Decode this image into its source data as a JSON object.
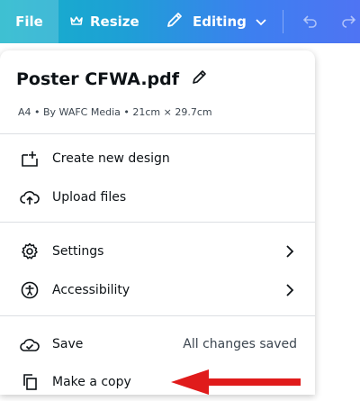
{
  "topbar": {
    "file_label": "File",
    "resize_label": "Resize",
    "editing_label": "Editing"
  },
  "panel": {
    "title": "Poster CFWA.pdf",
    "meta": "A4 • By WAFC Media • 21cm × 29.7cm",
    "items": [
      {
        "label": "Create new design",
        "icon": "create-new-design-icon"
      },
      {
        "label": "Upload files",
        "icon": "upload-cloud-icon"
      },
      {
        "label": "Settings",
        "icon": "gear-icon"
      },
      {
        "label": "Accessibility",
        "icon": "accessibility-icon"
      },
      {
        "label": "Save",
        "icon": "cloud-check-icon",
        "status": "All changes saved"
      },
      {
        "label": "Make a copy",
        "icon": "copy-icon"
      }
    ]
  },
  "colors": {
    "topbar_start": "#14b3c9",
    "topbar_end": "#4f74f3",
    "arrow": "#e01b1b"
  }
}
